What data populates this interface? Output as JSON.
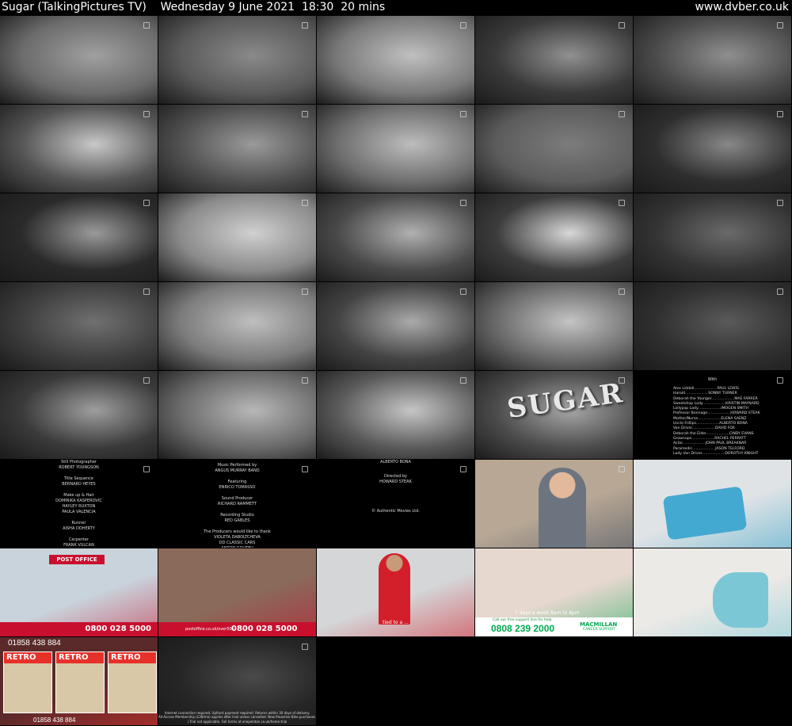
{
  "header": {
    "title": "Sugar (TalkingPictures TV)    Wednesday 9 June 2021  18:30  20 mins",
    "site": "www.dvber.co.uk"
  },
  "thumbnails": [
    {
      "id": "r1c1",
      "kind": "mono",
      "bg": "#6b6b6b",
      "accent": "#a0a0a0"
    },
    {
      "id": "r1c2",
      "kind": "mono",
      "bg": "#5a5a5a",
      "accent": "#8a8a8a"
    },
    {
      "id": "r1c3",
      "kind": "mono",
      "bg": "#7a7a7a",
      "accent": "#c0c0c0"
    },
    {
      "id": "r1c4",
      "kind": "mono",
      "bg": "#3a3a3a",
      "accent": "#909090"
    },
    {
      "id": "r1c5",
      "kind": "mono",
      "bg": "#4a4a4a",
      "accent": "#8f8f8f"
    },
    {
      "id": "r2c1",
      "kind": "mono",
      "bg": "#555555",
      "accent": "#c8c8c8"
    },
    {
      "id": "r2c2",
      "kind": "mono",
      "bg": "#505050",
      "accent": "#9a9a9a"
    },
    {
      "id": "r2c3",
      "kind": "mono",
      "bg": "#6e6e6e",
      "accent": "#bdbdbd"
    },
    {
      "id": "r2c4",
      "kind": "mono",
      "bg": "#5c5c5c",
      "accent": "#7c7c7c"
    },
    {
      "id": "r2c5",
      "kind": "mono",
      "bg": "#2e2e2e",
      "accent": "#888888"
    },
    {
      "id": "r3c1",
      "kind": "mono",
      "bg": "#2a2a2a",
      "accent": "#9a9a9a"
    },
    {
      "id": "r3c2",
      "kind": "mono",
      "bg": "#8a8a8a",
      "accent": "#d0d0d0"
    },
    {
      "id": "r3c3",
      "kind": "mono",
      "bg": "#4a4a4a",
      "accent": "#b0b0b0"
    },
    {
      "id": "r3c4",
      "kind": "mono",
      "bg": "#3c3c3c",
      "accent": "#d8d8d8"
    },
    {
      "id": "r3c5",
      "kind": "mono",
      "bg": "#333333",
      "accent": "#6a6a6a"
    },
    {
      "id": "r4c1",
      "kind": "mono",
      "bg": "#3e3e3e",
      "accent": "#707070"
    },
    {
      "id": "r4c2",
      "kind": "mono",
      "bg": "#7b7b7b",
      "accent": "#bfbfbf"
    },
    {
      "id": "r4c3",
      "kind": "mono",
      "bg": "#444444",
      "accent": "#aaaaaa"
    },
    {
      "id": "r4c4",
      "kind": "mono",
      "bg": "#6a6a6a",
      "accent": "#c4c4c4"
    },
    {
      "id": "r4c5",
      "kind": "mono",
      "bg": "#2f2f2f",
      "accent": "#5a5a5a"
    },
    {
      "id": "r5c1",
      "kind": "mono",
      "bg": "#3a3a3a",
      "accent": "#9e9e9e"
    },
    {
      "id": "r5c2",
      "kind": "mono",
      "bg": "#6a6a6a",
      "accent": "#b8b8b8"
    },
    {
      "id": "r5c3",
      "kind": "mono",
      "bg": "#5a5a5a",
      "accent": "#c6c6c6"
    },
    {
      "id": "r5c4",
      "kind": "mono",
      "bg": "#4c4c4c",
      "accent": "#a6a6a6"
    },
    {
      "id": "r5c5",
      "kind": "credits",
      "bg": "#000000",
      "accent": "#000000"
    },
    {
      "id": "r6c1",
      "kind": "credits",
      "bg": "#000000",
      "accent": "#000000"
    },
    {
      "id": "r6c2",
      "kind": "credits",
      "bg": "#000000",
      "accent": "#000000"
    },
    {
      "id": "r6c3",
      "kind": "credits",
      "bg": "#000000",
      "accent": "#000000"
    },
    {
      "id": "r6c4",
      "kind": "color",
      "bg": "#b7a794",
      "accent": "#3e4a5e"
    },
    {
      "id": "r6c5",
      "kind": "color",
      "bg": "#dfe3e6",
      "accent": "#3aa4c8"
    },
    {
      "id": "r7c1",
      "kind": "color",
      "bg": "#c9d3db",
      "accent": "#c8102e"
    },
    {
      "id": "r7c2",
      "kind": "color",
      "bg": "#8a6a5a",
      "accent": "#c8102e"
    },
    {
      "id": "r7c3",
      "kind": "color",
      "bg": "#d4d6d8",
      "accent": "#d21f2a"
    },
    {
      "id": "r7c4",
      "kind": "color",
      "bg": "#e6d7cf",
      "accent": "#00a94f"
    },
    {
      "id": "r7c5",
      "kind": "color",
      "bg": "#eceae6",
      "accent": "#7cc7d6"
    },
    {
      "id": "r8c1",
      "kind": "color",
      "bg": "#5a2a2a",
      "accent": "#e6312a"
    },
    {
      "id": "r8c2",
      "kind": "mono",
      "bg": "#262626",
      "accent": "#4a4a4a"
    }
  ],
  "captions": {
    "sugar_title": "SUGAR",
    "credits_cast_header": "With",
    "credits_cast": [
      [
        "Alex Liddell",
        "PAUL LEWIS"
      ],
      [
        "Harold",
        "SONNY TURNER"
      ],
      [
        "Deborah the Younger",
        "MAE FARRER"
      ],
      [
        "Sweetshop Lady",
        "KRISTIN MAYNARD"
      ],
      [
        "Lollypop Lady",
        "IMOGEN SMITH"
      ],
      [
        "Professor Bonnage",
        "HOWARD STEAK"
      ],
      [
        "Mother/Nurse",
        "ELENA SAENZ"
      ],
      [
        "Uncle Frillips",
        "ALBERTO BONA"
      ],
      [
        "Van Driver",
        "DAVID FOX"
      ],
      [
        "Deborah the Elder",
        "CINDY EVANS"
      ],
      [
        "Grownups",
        "RACHEL PERRATT"
      ],
      [
        "Actor",
        "JOHN PAUL BREAKNAR"
      ],
      [
        "Paramedic",
        "JASON TELFORD"
      ],
      [
        "Lady Van Driver",
        "DOROTHY KNIGHT"
      ]
    ],
    "credits_col1": "Still Photographer\nROBERT YOUNGSON\n\nTitle Sequence\nBERNARD HEYES\n\nMake up & Hair\nDOMINIKA KASPEROVIC\nHAYLEY RUXTON\nPAULA VALENCIA\n\nRunner\nAISHA DOHERTY\n\nCarpenter\nFRANK VULCAN\n\nCatering",
    "credits_col2": "Music Performed by\nANGUS MURRAY BAND\n\nFeaturing\nENRICO TOMASSO\n\nSound Producer\nRICHARD RAMMETT\n\nRecording Studio\nRED GABLES\n\nThe Producers would like to thank\nVIOLETA DABOLTCHEVA\nDD CLASSIC CARS\nANTON GOUTEV\nIRINA BARROW",
    "credits_col3_top": "ALBERTO BONA",
    "credits_col3_mid": "Directed by\nHOWARD STEAK",
    "credits_col3_bot": "© Authentic Movies Ltd.",
    "post_office_sign": "POST OFFICE",
    "post_office_phone": "0800 028 5000",
    "post_office_site": "postoffice.co.uk/over50s",
    "car_caption": "tied to a ...",
    "macmillan_line": "Call our free support line for help",
    "macmillan_hours": "7 days a week 8am to 8pm",
    "macmillan_phone": "0808 239 2000",
    "macmillan_brand": "MACMILLAN",
    "macmillan_sub": "CANCER SUPPORT",
    "retro_phone_top": "01858 438 884",
    "retro_phone_bottom": "01858 438 884",
    "retro_brand": "RETRO",
    "small_print": "Internet connection required. Upfront payment required. Returns within 30 days of delivery.\nAll-Access Membership (£28/mo) applies after trial unless cancelled. New Proactive Bike purchases only.\n| Trial not applicable. Full terms at onepeloton.co.uk/home-trial"
  }
}
